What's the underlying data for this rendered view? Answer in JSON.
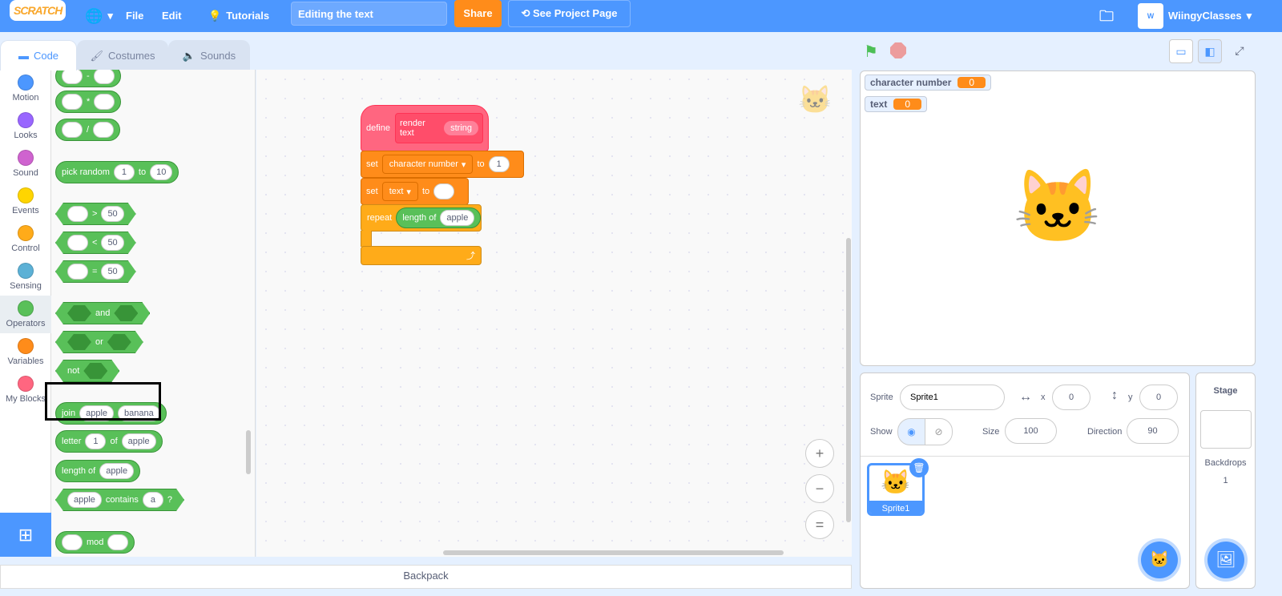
{
  "topbar": {
    "logo": "SCRATCH",
    "file": "File",
    "edit": "Edit",
    "tutorials": "Tutorials",
    "project_title": "Editing the text",
    "share": "Share",
    "see_project": "See Project Page",
    "username": "WiingyClasses"
  },
  "tabs": {
    "code": "Code",
    "costumes": "Costumes",
    "sounds": "Sounds"
  },
  "categories": [
    {
      "label": "Motion",
      "color": "#4c97ff"
    },
    {
      "label": "Looks",
      "color": "#9966ff"
    },
    {
      "label": "Sound",
      "color": "#cf63cf"
    },
    {
      "label": "Events",
      "color": "#ffd500"
    },
    {
      "label": "Control",
      "color": "#ffab19"
    },
    {
      "label": "Sensing",
      "color": "#5cb1d6"
    },
    {
      "label": "Operators",
      "color": "#59c059"
    },
    {
      "label": "Variables",
      "color": "#ff8c1a"
    },
    {
      "label": "My Blocks",
      "color": "#ff6680"
    }
  ],
  "palette": {
    "minus": "-",
    "times": "*",
    "divide": "/",
    "pick_random": "pick random",
    "pr_from": "1",
    "to": "to",
    "pr_to": "10",
    "gt": ">",
    "lt": "<",
    "eq": "=",
    "fifty": "50",
    "and": "and",
    "or": "or",
    "not": "not",
    "join": "join",
    "apple": "apple",
    "banana": "banana",
    "letter": "letter",
    "one": "1",
    "of": "of",
    "length_of": "length of",
    "contains": "contains",
    "a": "a",
    "q": "?",
    "mod": "mod"
  },
  "script": {
    "define": "define",
    "proc_name": "render text",
    "param": "string",
    "set": "set",
    "var1": "character number",
    "to": "to",
    "val1": "1",
    "var2": "text",
    "repeat": "repeat",
    "length_of": "length of",
    "apple": "apple"
  },
  "zoom": {
    "in": "+",
    "out": "−",
    "reset": "="
  },
  "backpack": "Backpack",
  "monitors": [
    {
      "name": "character number",
      "value": "0"
    },
    {
      "name": "text",
      "value": "0"
    }
  ],
  "sprite_info": {
    "sprite_label": "Sprite",
    "sprite_name": "Sprite1",
    "x_label": "x",
    "x": "0",
    "y_label": "y",
    "y": "0",
    "show_label": "Show",
    "size_label": "Size",
    "size": "100",
    "direction_label": "Direction",
    "direction": "90"
  },
  "sprites": [
    {
      "name": "Sprite1"
    }
  ],
  "stage_pane": {
    "title": "Stage",
    "backdrops_label": "Backdrops",
    "backdrops": "1"
  }
}
